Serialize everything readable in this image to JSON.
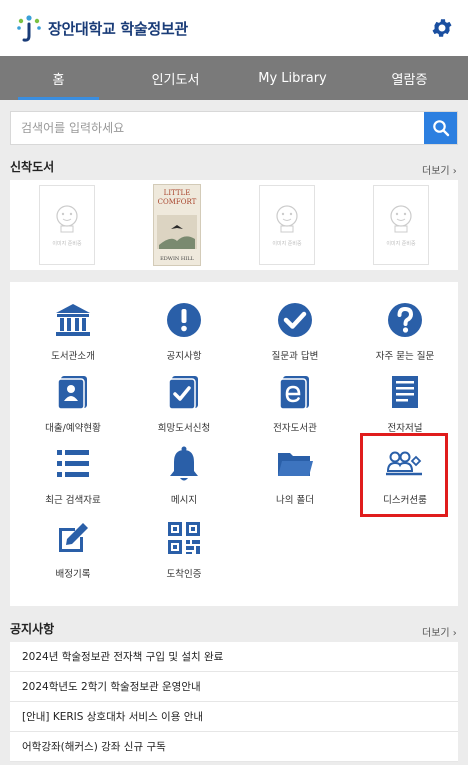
{
  "header": {
    "title": "장안대학교 학술정보관"
  },
  "tabs": [
    {
      "label": "홈"
    },
    {
      "label": "인기도서"
    },
    {
      "label": "My Library"
    },
    {
      "label": "열람증"
    }
  ],
  "search": {
    "placeholder": "검색어를 입력하세요"
  },
  "new_books": {
    "title": "신착도서",
    "more": "더보기",
    "placeholder_label": "이미지 준비중",
    "cover": {
      "title_line1": "LITTLE",
      "title_line2": "COMFORT",
      "author": "EDWIN HILL"
    }
  },
  "menu": [
    {
      "label": "도서관소개",
      "icon": "library-building-icon"
    },
    {
      "label": "공지사항",
      "icon": "exclamation-icon"
    },
    {
      "label": "질문과 답변",
      "icon": "check-circle-icon"
    },
    {
      "label": "자주 묻는 질문",
      "icon": "question-icon"
    },
    {
      "label": "대출/예약현황",
      "icon": "person-card-icon"
    },
    {
      "label": "희망도서신청",
      "icon": "checkbox-card-icon"
    },
    {
      "label": "전자도서관",
      "icon": "ebook-icon"
    },
    {
      "label": "전자저널",
      "icon": "journal-icon"
    },
    {
      "label": "최근 검색자료",
      "icon": "list-icon"
    },
    {
      "label": "메시지",
      "icon": "bell-icon"
    },
    {
      "label": "나의 폴더",
      "icon": "folder-icon"
    },
    {
      "label": "디스커션룸",
      "icon": "discussion-room-icon"
    },
    {
      "label": "배정기록",
      "icon": "edit-icon"
    },
    {
      "label": "도착인증",
      "icon": "qr-code-icon"
    }
  ],
  "notices": {
    "title": "공지사항",
    "more": "더보기",
    "items": [
      "2024년 학술정보관 전자책 구입 및 설치 완료",
      "2024학년도 2학기 학술정보관 운영안내",
      "[안내] KERIS 상호대차 서비스 이용 안내",
      "어학강좌(해커스) 강좌 신규 구독"
    ]
  },
  "colors": {
    "brand": "#1a3c78",
    "accent": "#2c7fe0",
    "icon": "#2a5fa8",
    "tabbar": "#7a7a7a",
    "highlight": "#e01c1c"
  }
}
